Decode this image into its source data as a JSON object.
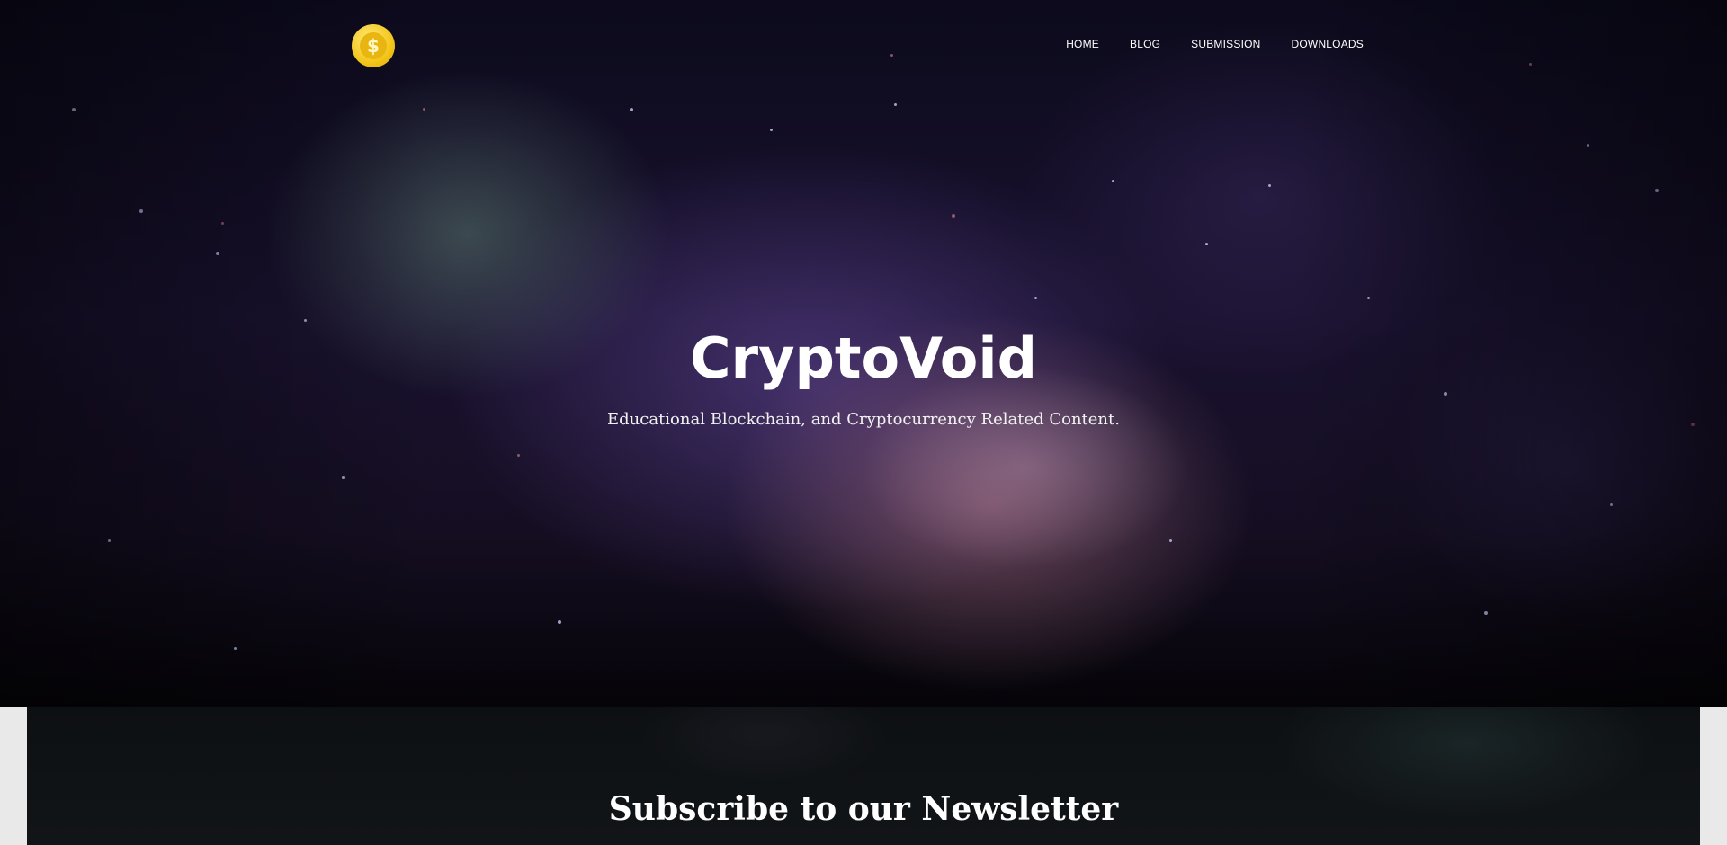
{
  "nav": {
    "items": [
      {
        "label": "HOME"
      },
      {
        "label": "BLOG"
      },
      {
        "label": "SUBMISSION"
      },
      {
        "label": "DOWNLOADS"
      }
    ]
  },
  "logo": {
    "icon": "dollar-coin-icon",
    "symbol": "$",
    "color": "#f3c61a"
  },
  "hero": {
    "title": "CryptoVoid",
    "subtitle": "Educational Blockchain, and Cryptocurrency Related Content."
  },
  "newsletter": {
    "title": "Subscribe to our Newsletter"
  }
}
